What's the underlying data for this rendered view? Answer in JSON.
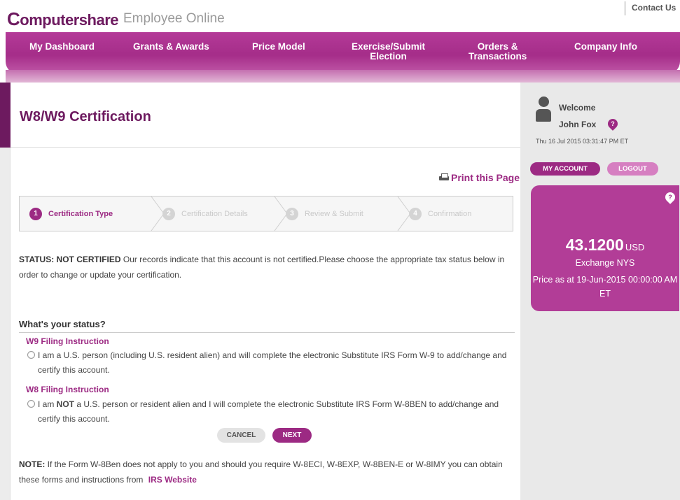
{
  "header": {
    "logo_mark": "C",
    "logo_text": "omputershare",
    "logo_sub": "Employee Online",
    "contact": "Contact Us"
  },
  "nav": {
    "items": [
      {
        "label": "My Dashboard"
      },
      {
        "label": "Grants & Awards"
      },
      {
        "label": "Price Model"
      },
      {
        "label": "Exercise/Submit",
        "label2": "Election"
      },
      {
        "label": "Orders &",
        "label2": "Transactions"
      },
      {
        "label": "Company Info"
      }
    ]
  },
  "page": {
    "title": "W8/W9 Certification",
    "print": "Print this Page"
  },
  "steps": [
    {
      "num": "1",
      "label": "Certification Type"
    },
    {
      "num": "2",
      "label": "Certification Details"
    },
    {
      "num": "3",
      "label": "Review & Submit"
    },
    {
      "num": "4",
      "label": "Confirmation"
    }
  ],
  "status": {
    "label": "STATUS: NOT CERTIFIED",
    "text": " Our records indicate that this account is not certified.Please choose the appropriate tax status below in order to change or update your certification."
  },
  "question": {
    "title": "What's your status?",
    "w9_instruction": "W9 Filing Instruction",
    "w9_text": "I am a U.S. person (including U.S. resident alien) and will complete the electronic Substitute IRS Form W-9 to add/change and certify this account.",
    "w8_instruction": "W8 Filing Instruction",
    "w8_pre": "I am ",
    "w8_bold": "NOT",
    "w8_text": " a U.S. person or resident alien and I will complete the electronic Substitute IRS Form W-8BEN to add/change and certify this account."
  },
  "buttons": {
    "cancel": "CANCEL",
    "next": "NEXT"
  },
  "note": {
    "label": "NOTE:",
    "text": " If the Form W-8Ben does not apply to you and should you require W-8ECI, W-8EXP, W-8BEN-E or W-8IMY you can obtain these forms and instructions from ",
    "link": "IRS Website"
  },
  "sidebar": {
    "welcome": "Welcome",
    "user": "John Fox",
    "help": "?",
    "timestamp": "Thu 16 Jul 2015 03:31:47 PM ET",
    "my_account": "MY ACCOUNT",
    "logout": "LOGOUT",
    "price": "43.1200",
    "currency": "USD",
    "exchange": "Exchange NYS",
    "price_as": "Price as at 19-Jun-2015 00:00:00 AM ET"
  },
  "colors": {
    "brand": "#9c2a83",
    "brand_dark": "#6d1a5f",
    "nav": "#a52d89"
  }
}
